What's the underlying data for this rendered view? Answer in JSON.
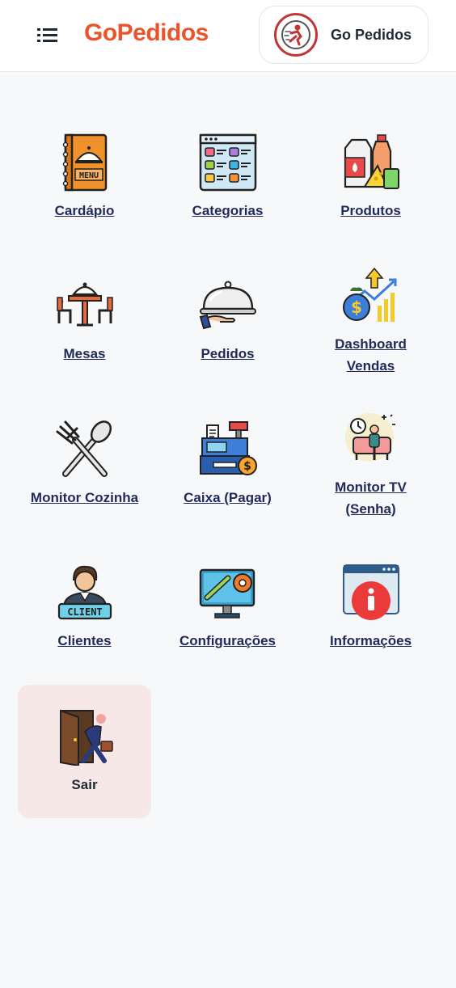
{
  "header": {
    "brand": "GoPedidos",
    "profile_name": "Go Pedidos"
  },
  "menu": {
    "items": [
      {
        "label": "Cardápio",
        "icon": "menu-book-icon"
      },
      {
        "label": "Categorias",
        "icon": "categories-grid-icon"
      },
      {
        "label": "Produtos",
        "icon": "products-icon"
      },
      {
        "label": "Mesas",
        "icon": "table-icon"
      },
      {
        "label": "Pedidos",
        "icon": "cloche-icon"
      },
      {
        "label": "Dashboard Vendas",
        "icon": "sales-chart-icon"
      },
      {
        "label": "Monitor Cozinha",
        "icon": "fork-spoon-icon"
      },
      {
        "label": "Caixa (Pagar)",
        "icon": "cash-register-icon"
      },
      {
        "label": "Monitor TV (Senha)",
        "icon": "waiting-room-icon"
      },
      {
        "label": "Clientes",
        "icon": "client-icon"
      },
      {
        "label": "Configurações",
        "icon": "settings-monitor-icon"
      },
      {
        "label": "Informações",
        "icon": "info-icon"
      }
    ],
    "exit": {
      "label": "Sair",
      "icon": "exit-door-icon"
    }
  },
  "colors": {
    "brand": "#e8552d",
    "background": "#f6f8fa",
    "link": "#1f2a5a",
    "exit_tile": "#f7e8e8"
  }
}
